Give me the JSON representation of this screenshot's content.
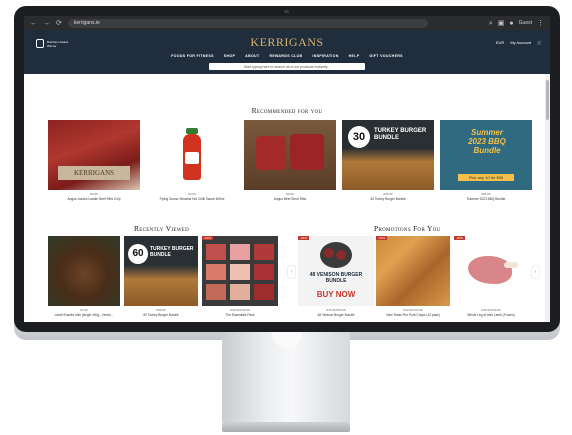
{
  "browser": {
    "url": "kerrigans.ie",
    "profile_label": "Guest"
  },
  "site": {
    "brand_small": "Butchers Award Winner",
    "logo": "KERRIGANS",
    "logo_sub": "",
    "currency": "EUR",
    "account_label": "My Account",
    "nav": [
      "FOODS FOR FITNESS",
      "SHOP",
      "ABOUT",
      "REWARDS CLUB",
      "INSPIRATION",
      "HELP",
      "GIFT VOUCHERS"
    ],
    "search_placeholder": "Start typing here to search all of our products instantly..."
  },
  "recommended": {
    "title": "Recommended for you",
    "items": [
      {
        "title": "Angus Jacobs Ladder Beef Ribs Chip",
        "price": "€9.99"
      },
      {
        "title": "Flying Goose Sriracha Hot Chilli Sauce 455ml",
        "price": "€4.99"
      },
      {
        "title": "Angus Beef Short Ribs",
        "price": "€9.99"
      },
      {
        "title": "30 Turkey Burger Bundle",
        "price": "€35.00",
        "badge_num": "30",
        "badge_text": "TURKEY BURGER BUNDLE"
      },
      {
        "title": "Summer 2023 BBQ Bundle",
        "price": "€55.00",
        "badge_text": "Summer 2023 BBQ Bundle",
        "badge_sub": "Pick any 10 for €55"
      }
    ]
  },
  "recently_viewed": {
    "title": "Recently Viewed",
    "items": [
      {
        "title": "Lamb Shanks Irish (single 400g - 2ench...",
        "price": "€7.99"
      },
      {
        "title": "60 Turkey Burger Bundle",
        "price": "€59.99",
        "badge_num": "60",
        "badge_text": "TURKEY BURGER BUNDLE"
      },
      {
        "title": "The Essentials Pack",
        "price": "€49.99 €45.00",
        "sale": "-10%"
      }
    ]
  },
  "promotions": {
    "title": "Promotions For You",
    "items": [
      {
        "title": "48 Venison Burger Bundle",
        "price": "€75.00 €59.99",
        "sale": "-20%",
        "badge_text": "48 VENISON BURGER BUNDLE",
        "cta": "BUY NOW"
      },
      {
        "title": "New Texas Fire Pork Chops (12 pack)",
        "price": "€19.99 €16.99",
        "sale": "-15%"
      },
      {
        "title": "Whole Leg of Irish Lamb (Frozen)",
        "price": "€49.99 €39.99",
        "sale": "-20%"
      }
    ]
  },
  "colors": {
    "header_bg": "#1f2d3d",
    "gold": "#d9b26a",
    "sale_red": "#c0392b"
  }
}
